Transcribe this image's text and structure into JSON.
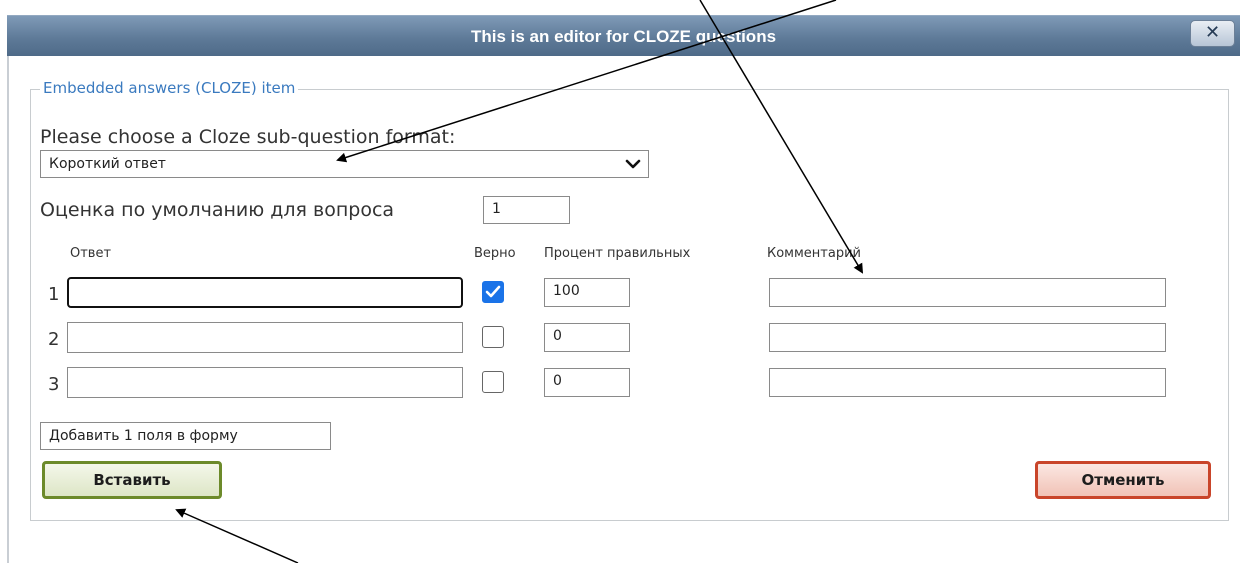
{
  "dialog": {
    "title": "This is an editor for CLOZE questions",
    "close_label": "✕"
  },
  "form": {
    "legend": "Embedded answers (CLOZE) item",
    "format_prompt": "Please choose a Cloze sub-question format:",
    "format_selected": "Короткий ответ",
    "default_grade_label": "Оценка по умолчанию для вопроса",
    "default_grade_value": "1",
    "columns": {
      "answer": "Ответ",
      "correct": "Верно",
      "percent": "Процент правильных",
      "comment": "Комментарий"
    },
    "rows": [
      {
        "num": "1",
        "answer": "",
        "correct": true,
        "percent": "100",
        "comment": ""
      },
      {
        "num": "2",
        "answer": "",
        "correct": false,
        "percent": "0",
        "comment": ""
      },
      {
        "num": "3",
        "answer": "",
        "correct": false,
        "percent": "0",
        "comment": ""
      }
    ],
    "add_fields_label": "Добавить 1 поля в форму",
    "insert_label": "Вставить",
    "cancel_label": "Отменить"
  },
  "colors": {
    "legend": "#3a7abf",
    "checkbox_checked": "#1a73e8",
    "insert_border": "#6c8a2a",
    "cancel_border": "#c9452a"
  },
  "icons": {
    "select": "chevron-down-icon",
    "close": "close-icon",
    "check": "checkmark-icon"
  }
}
